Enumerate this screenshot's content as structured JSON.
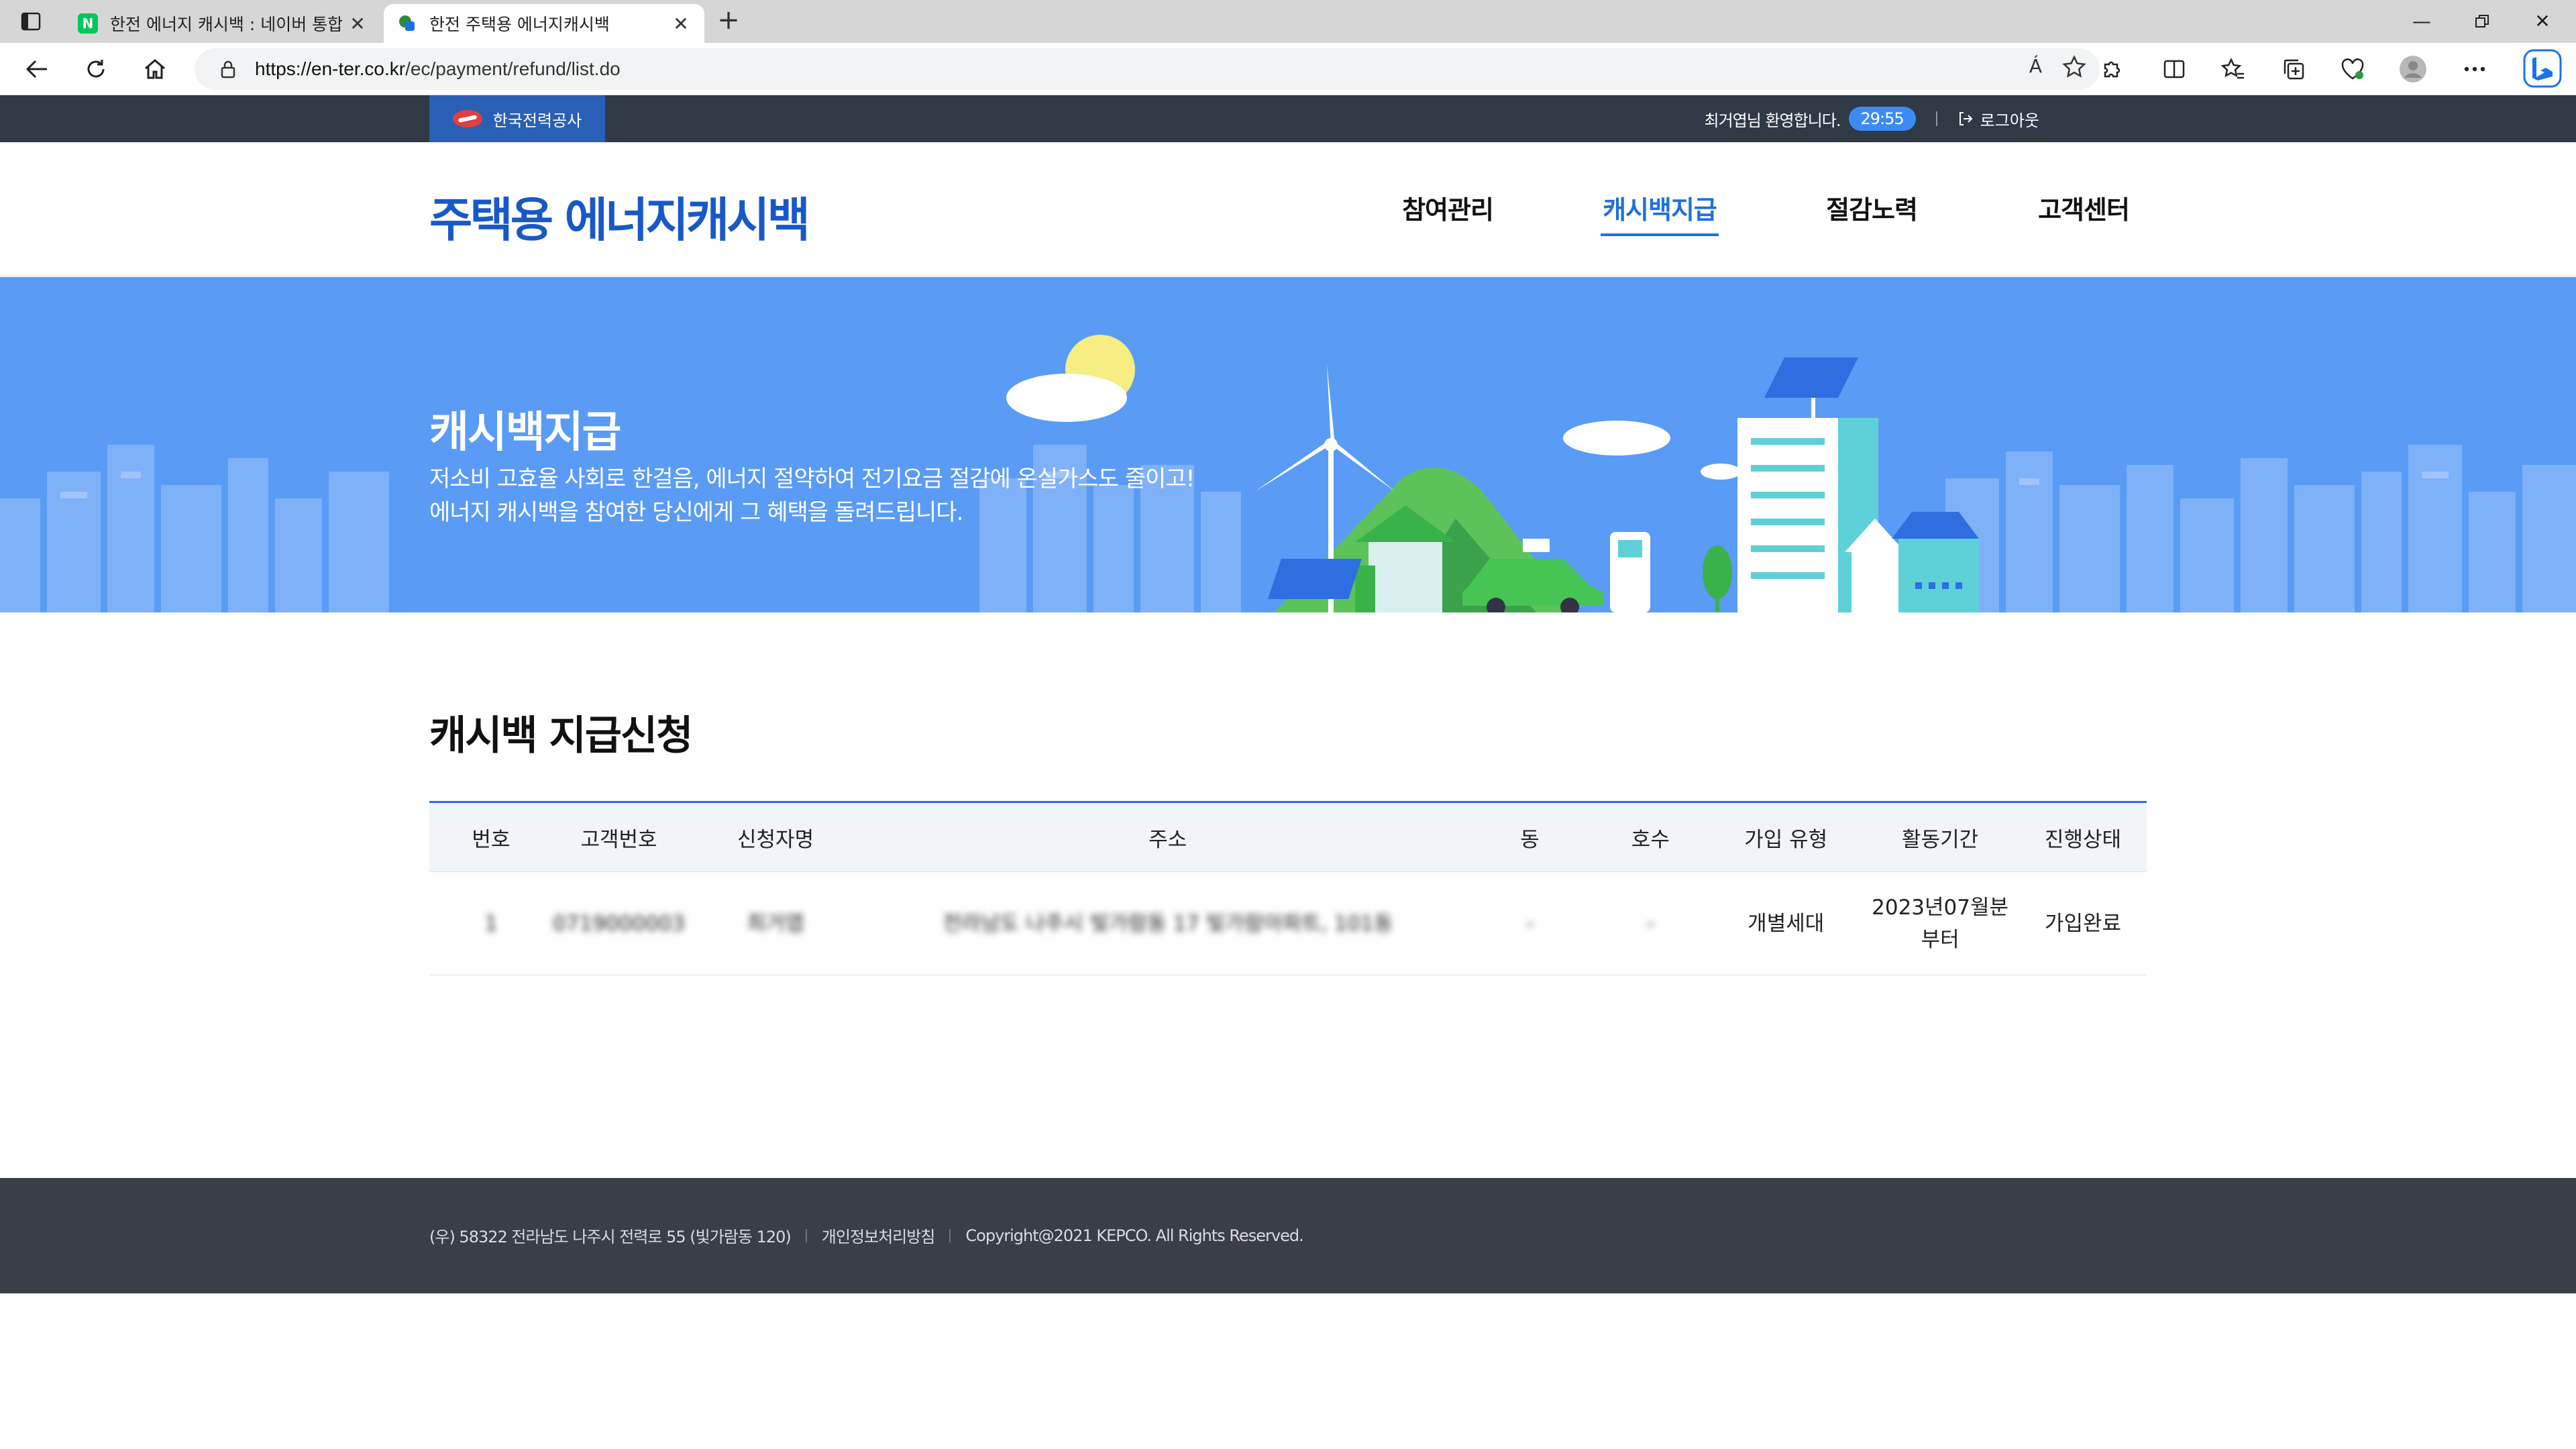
{
  "browser": {
    "tabs": [
      {
        "title": "한전 에너지 캐시백 : 네이버 통합",
        "favicon": "N",
        "active": false
      },
      {
        "title": "한전 주택용 에너지캐시백",
        "favicon": "e",
        "active": true
      }
    ],
    "new_tab": "+",
    "url_host": "https://en-ter.co.kr",
    "url_path": "/ec/payment/refund/list.do",
    "read_aloud_label": "Á"
  },
  "topbar": {
    "org_name": "한국전력공사",
    "welcome": "최거엽님 환영합니다.",
    "timer": "29:55",
    "logout": "로그아웃"
  },
  "header": {
    "brand": "주택용 에너지캐시백",
    "nav": [
      "참여관리",
      "캐시백지급",
      "절감노력",
      "고객센터"
    ],
    "active_nav_index": 1
  },
  "hero": {
    "title": "캐시백지급",
    "desc_line1": "저소비 고효율 사회로 한걸음, 에너지 절약하여 전기요금 절감에 온실가스도 줄이고!",
    "desc_line2": "에너지 캐시백을 참여한 당신에게 그 혜택을 돌려드립니다."
  },
  "content": {
    "title": "캐시백 지급신청",
    "table": {
      "headers": [
        "번호",
        "고객번호",
        "신청자명",
        "주소",
        "동",
        "호수",
        "가입 유형",
        "활동기간",
        "진행상태"
      ],
      "rows": [
        {
          "no": "1",
          "customer_no": "0719000003",
          "name": "최거엽",
          "address": "전라남도 나주시 빛가람동 17 빛가람아파트, 101동",
          "dong": "-",
          "ho": "-",
          "join_type": "개별세대",
          "period_line1": "2023년07월분",
          "period_line2": "부터",
          "status": "가입완료"
        }
      ]
    }
  },
  "footer": {
    "address": "(우) 58322 전라남도 나주시 전력로 55 (빛가람동 120)",
    "privacy": "개인정보처리방침",
    "copyright": "Copyright@2021 KEPCO. All Rights Reserved."
  },
  "colors": {
    "brand_blue": "#1859c7",
    "accent_blue": "#1f6fe0",
    "hero_bg": "#5a9bf6",
    "topbar_bg": "#2f3a45",
    "footer_bg": "#3a3e47"
  }
}
